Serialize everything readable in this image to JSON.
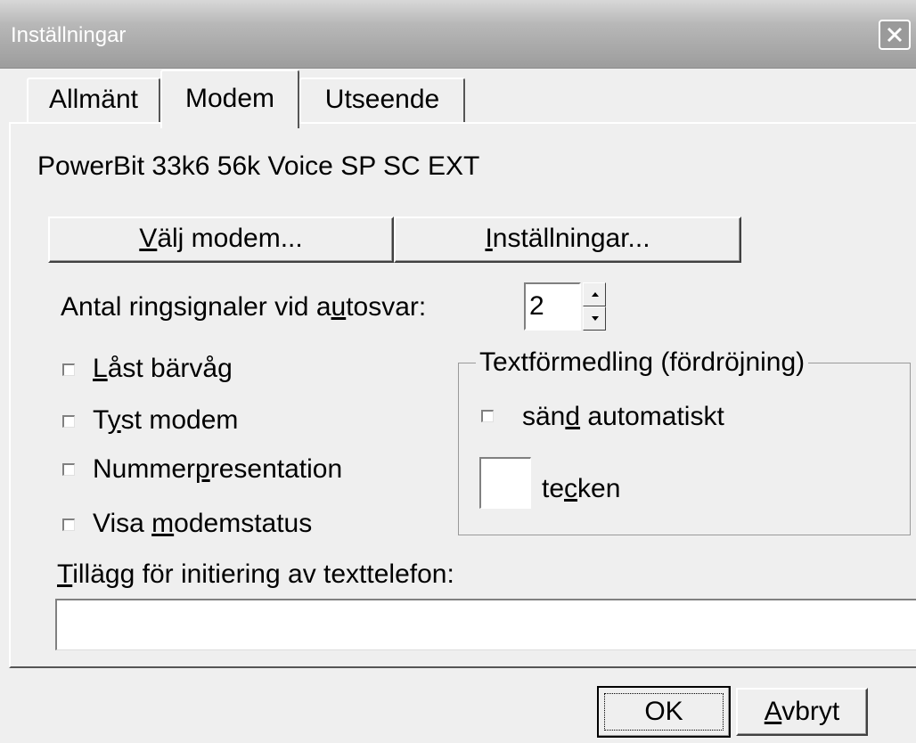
{
  "window": {
    "title": "Inställningar"
  },
  "tabs": [
    {
      "label": "Allmänt",
      "active": false
    },
    {
      "label": "Modem",
      "active": true
    },
    {
      "label": "Utseende",
      "active": false
    }
  ],
  "modem": {
    "name": "PowerBit 33k6 56k Voice SP SC EXT",
    "select_button": {
      "underline": "V",
      "rest": "älj modem..."
    },
    "settings_button": {
      "underline": "I",
      "rest": "nställningar..."
    }
  },
  "rings": {
    "label_before": "Antal ringsignaler vid a",
    "label_underline": "u",
    "label_after": "tosvar:",
    "value": "2"
  },
  "checkboxes": [
    {
      "pre": "",
      "underline": "L",
      "post": "åst bärvåg",
      "checked": false
    },
    {
      "pre": "T",
      "underline": "y",
      "post": "st modem",
      "checked": false
    },
    {
      "pre": "Nummer",
      "underline": "p",
      "post": "resentation",
      "checked": false
    },
    {
      "pre": "Visa ",
      "underline": "m",
      "post": "odemstatus",
      "checked": false
    }
  ],
  "text_relay": {
    "title": "Textförmedling (fördröjning)",
    "auto_send": {
      "pre": "sän",
      "underline": "d",
      "post": " automatiskt",
      "checked": false
    },
    "chars_value": "",
    "chars_label": {
      "pre": "te",
      "underline": "c",
      "post": "ken"
    }
  },
  "init": {
    "label_underline": "T",
    "label_rest": "illägg  för initiering av texttelefon:",
    "value": ""
  },
  "footer": {
    "ok_label": "OK",
    "cancel": {
      "underline": "A",
      "rest": "vbryt"
    }
  },
  "colors": {
    "dialog_bg": "#efefef",
    "titlebar": "#a9a9a9",
    "title_text": "#ffffff"
  }
}
